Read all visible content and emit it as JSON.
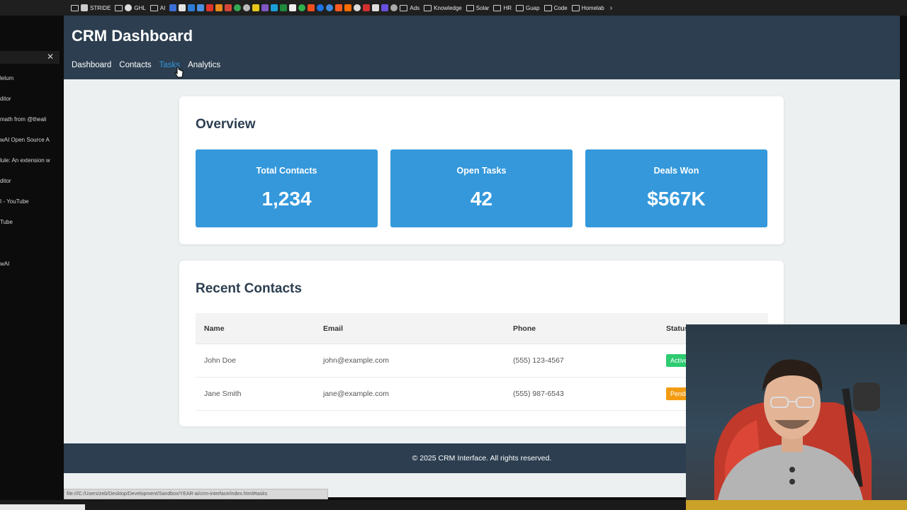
{
  "bookmarks": {
    "items": [
      "STRIDE",
      "GHL",
      "AI",
      "Ads",
      "Knowledge",
      "Solar",
      "HR",
      "Guap",
      "Code",
      "Homelab"
    ]
  },
  "sidebar": {
    "items": [
      "lelum",
      "ditor",
      "math from @theali",
      "wAI Open Source A",
      "lule: An extension w",
      "ditor",
      "I - YouTube",
      "Tube",
      "wAI"
    ]
  },
  "app": {
    "title": "CRM Dashboard",
    "nav": [
      "Dashboard",
      "Contacts",
      "Tasks",
      "Analytics"
    ],
    "hovered_nav": "Tasks",
    "accent_color": "#3498db",
    "header_color": "#2c3e50"
  },
  "overview": {
    "title": "Overview",
    "stats": [
      {
        "label": "Total Contacts",
        "value": "1,234"
      },
      {
        "label": "Open Tasks",
        "value": "42"
      },
      {
        "label": "Deals Won",
        "value": "$567K"
      }
    ]
  },
  "recent": {
    "title": "Recent Contacts",
    "columns": [
      "Name",
      "Email",
      "Phone",
      "Status"
    ],
    "rows": [
      {
        "name": "John Doe",
        "email": "john@example.com",
        "phone": "(555) 123-4567",
        "status": "Active"
      },
      {
        "name": "Jane Smith",
        "email": "jane@example.com",
        "phone": "(555) 987-6543",
        "status": "Pending"
      }
    ]
  },
  "footer": {
    "text": "© 2025 CRM Interface. All rights reserved."
  },
  "status_bar": {
    "url": "file:///C:/Users/zeb/Desktop/Development/Sandbox/YEAR-ai/crm-interface/index.html#tasks"
  }
}
